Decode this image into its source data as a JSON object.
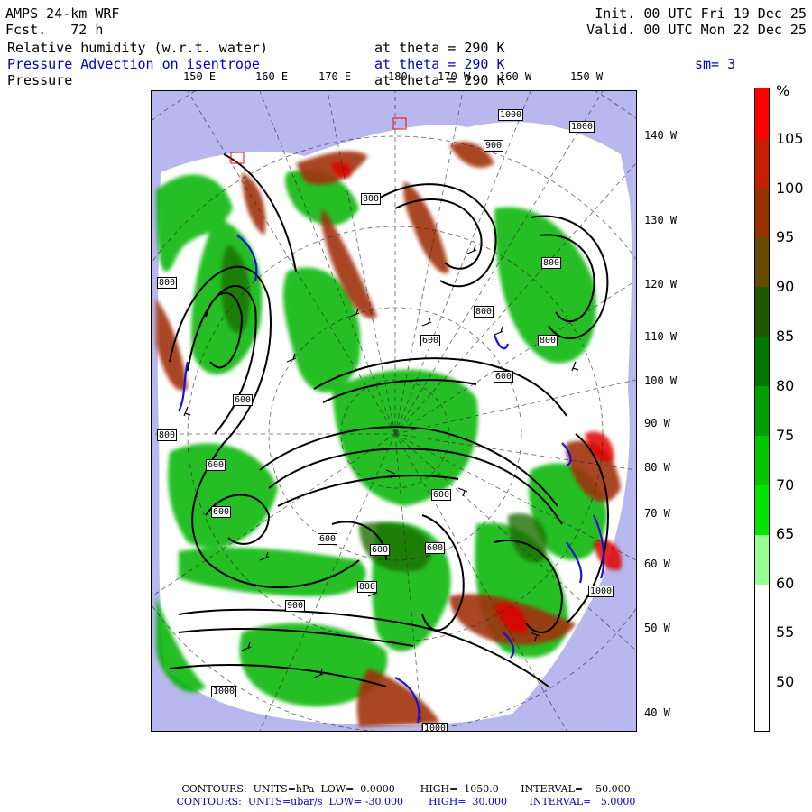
{
  "header": {
    "model": "AMPS 24-km WRF",
    "fcst": "Fcst.   72 h",
    "init": "Init. 00 UTC Fri 19 Dec 25",
    "valid": "Valid. 00 UTC Mon 22 Dec 25",
    "line1_field": "Relative humidity (w.r.t. water)",
    "line1_level": "at theta = 290 K",
    "line2_field": "Pressure Advection on isentrope",
    "line2_level": "at theta = 290 K",
    "line2_smooth": "sm= 3",
    "line3_field": "Pressure",
    "line3_level": "at theta = 290 K"
  },
  "map": {
    "lon_labels_top": [
      "150 E",
      "160 E",
      "170 E",
      "180",
      "170 W",
      "160 W",
      "150 W"
    ],
    "lon_labels_right": [
      "140 W",
      "130 W",
      "120 W",
      "110 W",
      "100 W",
      "90 W",
      "80 W",
      "70 W",
      "60 W",
      "50 W",
      "40 W"
    ],
    "contour_labels": [
      "1000",
      "1000",
      "900",
      "800",
      "800",
      "800",
      "800",
      "800",
      "800",
      "600",
      "600",
      "600",
      "600",
      "600",
      "600",
      "600",
      "600",
      "600",
      "800",
      "900",
      "1000",
      "1000",
      "1000"
    ]
  },
  "colorbar": {
    "unit": "%",
    "ticks": [
      "105",
      "100",
      "95",
      "90",
      "85",
      "80",
      "75",
      "70",
      "65",
      "60",
      "55",
      "50"
    ],
    "colors": [
      "#ff0000",
      "#c81e00",
      "#963200",
      "#644b00",
      "#1e5a00",
      "#007800",
      "#00a000",
      "#00c800",
      "#00e600",
      "#96ff96",
      "#ffffff",
      "#ffffff"
    ]
  },
  "footer": {
    "line1": "CONTOURS:  UNITS=hPa  LOW=  0.0000        HIGH=  1050.0       INTERVAL=    50.000",
    "line2": "CONTOURS:  UNITS=ubar/s  LOW= -30.000        HIGH=  30.000       INTERVAL=   5.0000"
  }
}
